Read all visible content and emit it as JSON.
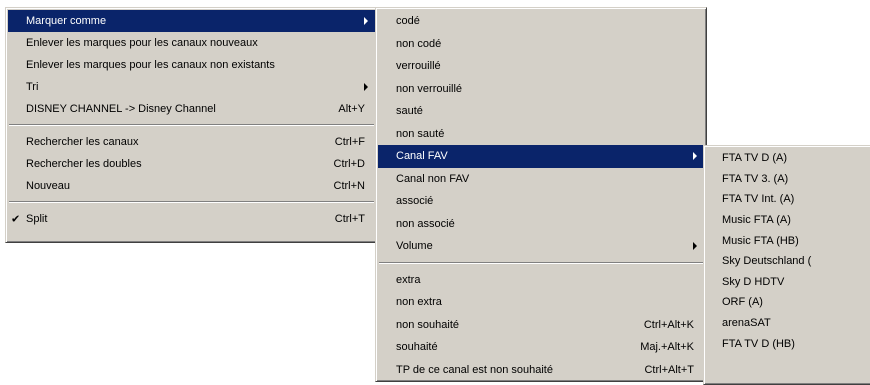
{
  "menu1": {
    "marquer": "Marquer comme",
    "enlever_nouveaux": "Enlever les marques pour les canaux nouveaux",
    "enlever_non_existants": "Enlever les marques pour les canaux non existants",
    "tri": "Tri",
    "disney": {
      "label": "DISNEY CHANNEL -> Disney Channel",
      "shortcut": "Alt+Y"
    },
    "rechercher_canaux": {
      "label": "Rechercher les canaux",
      "shortcut": "Ctrl+F"
    },
    "rechercher_doubles": {
      "label": "Rechercher les doubles",
      "shortcut": "Ctrl+D"
    },
    "nouveau": {
      "label": "Nouveau",
      "shortcut": "Ctrl+N"
    },
    "split": {
      "check": "✔",
      "label": "Split",
      "shortcut": "Ctrl+T"
    }
  },
  "menu2": {
    "code": "codé",
    "non_code": "non codé",
    "verrouille": "verrouillé",
    "non_verrouille": "non verrouillé",
    "saute": "sauté",
    "non_saute": "non sauté",
    "canal_fav": "Canal FAV",
    "canal_non_fav": "Canal non FAV",
    "associe": "associé",
    "non_associe": "non associé",
    "volume": "Volume",
    "extra": "extra",
    "non_extra": "non extra",
    "non_souhaite": {
      "label": "non souhaité",
      "shortcut": "Ctrl+Alt+K"
    },
    "souhaite": {
      "label": "souhaité",
      "shortcut": "Maj.+Alt+K"
    },
    "tp": {
      "label": "TP de ce canal est non souhaité",
      "shortcut": "Ctrl+Alt+T"
    }
  },
  "menu3": {
    "items": [
      "FTA TV D (A)",
      "FTA TV 3. (A)",
      "FTA TV Int. (A)",
      "Music FTA (A)",
      "Music FTA (HB)",
      "Sky Deutschland (",
      "Sky D HDTV",
      "ORF (A)",
      "arenaSAT",
      "FTA TV D (HB)"
    ]
  },
  "colors": {
    "menu_bg": "#d4d0c8",
    "highlight": "#0a246a",
    "highlight_text": "#ffffff"
  }
}
